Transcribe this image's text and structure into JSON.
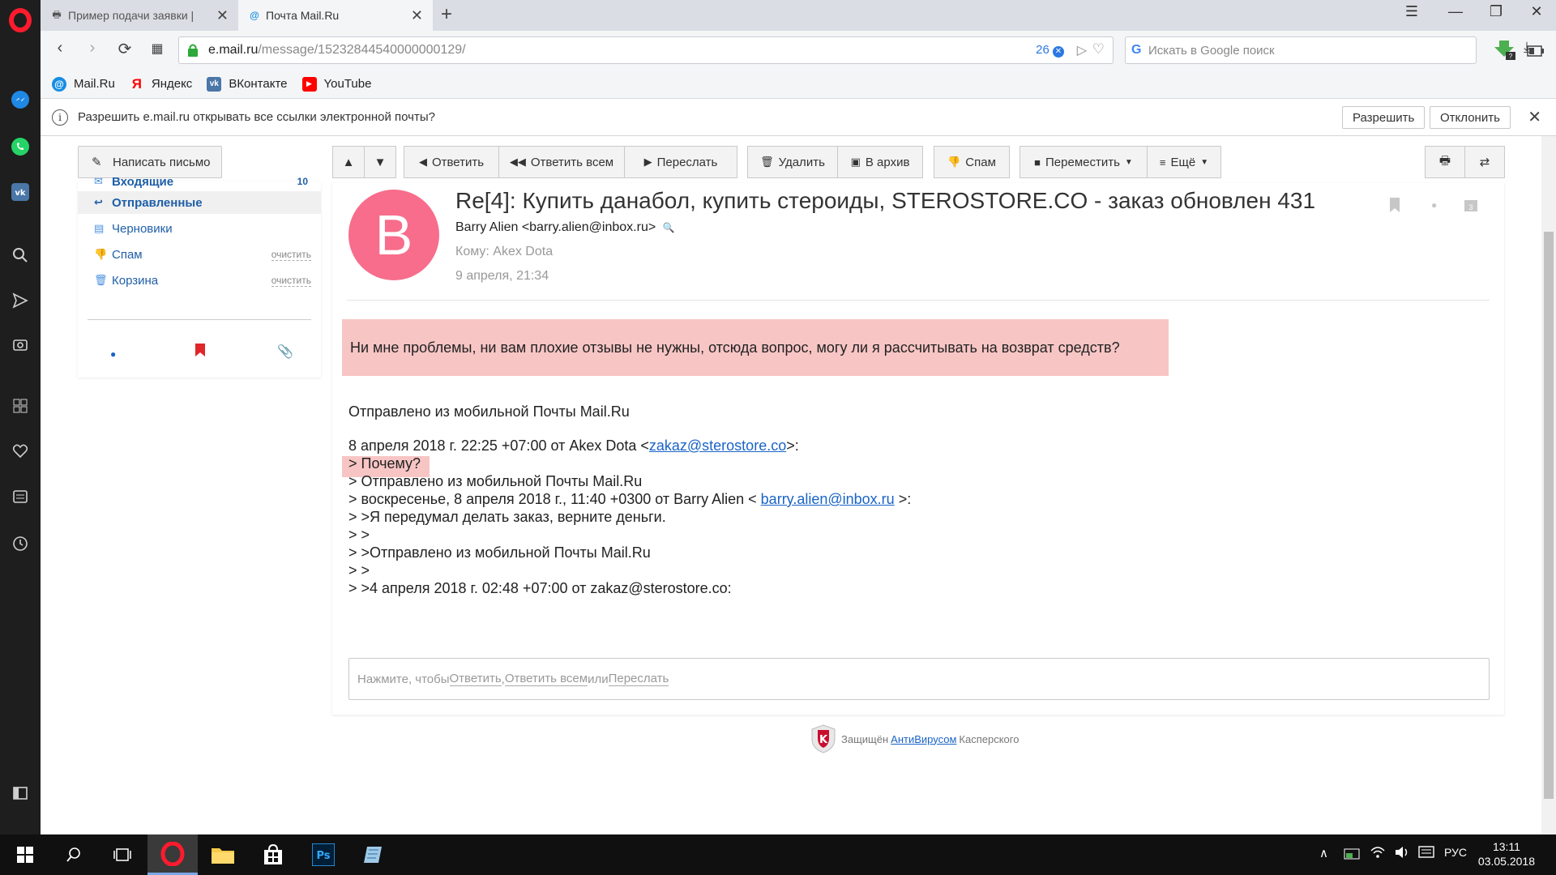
{
  "browser": {
    "tabs": [
      {
        "label": "Пример подачи заявки | ",
        "active": false
      },
      {
        "label": "Почта Mail.Ru",
        "active": true
      }
    ],
    "url_domain": "e.mail.ru",
    "url_path": "/message/15232844540000000129/",
    "url_badge_count": "26",
    "search_placeholder": "Искать в Google поиск",
    "bookmarks": [
      {
        "label": "Mail.Ru",
        "icon": "mailru-icon"
      },
      {
        "label": "Яндекс",
        "icon": "yandex-icon"
      },
      {
        "label": "ВКонтакте",
        "icon": "vk-icon"
      },
      {
        "label": "YouTube",
        "icon": "youtube-icon"
      }
    ],
    "infobar": {
      "text": "Разрешить e.mail.ru открывать все ссылки электронной почты?",
      "allow_label": "Разрешить",
      "deny_label": "Отклонить"
    }
  },
  "mail": {
    "compose_label": "Написать письмо",
    "folders": [
      {
        "label": "Входящие",
        "count": "10"
      },
      {
        "label": "Отправленные",
        "active": true
      },
      {
        "label": "Черновики"
      },
      {
        "label": "Спам",
        "action": "очистить"
      },
      {
        "label": "Корзина",
        "action": "очистить"
      }
    ],
    "toolbar": {
      "reply": "Ответить",
      "reply_all": "Ответить всем",
      "forward": "Переслать",
      "delete": "Удалить",
      "archive": "В архив",
      "spam": "Спам",
      "move": "Переместить",
      "more": "Ещё"
    },
    "message": {
      "avatar_letter": "B",
      "subject": "Re[4]: Купить данабол, купить стероиды, STEROSTORE.CO - заказ обновлен 431",
      "from": "Barry Alien <barry.alien@inbox.ru>",
      "to": "Кому: Akex Dota",
      "date": "9 апреля, 21:34",
      "highlight": "Ни мне проблемы, ни вам плохие отзывы не нужны, отсюда вопрос, могу ли я рассчитывать на возврат средств?",
      "sent_from": "Отправлено из мобильной Почты Mail.Ru",
      "quote_header_pre": "8 апреля 2018 г. 22:25 +07:00 от Akex Dota <",
      "quote_header_link": "zakaz@sterostore.co",
      "quote_header_post": ">:",
      "q1": "> Почему?",
      "q2": "> Отправлено из мобильной Почты Mail.Ru",
      "q3_pre": "> воскресенье, 8 апреля 2018 г., 11:40 +0300 от Barry Alien < ",
      "q3_link": "barry.alien@inbox.ru",
      "q3_post": " >:",
      "q4": "> >Я передумал делать заказ, верните деньги.",
      "q5": "> >",
      "q6": "> >Отправлено из мобильной Почты Mail.Ru",
      "q7": "> >",
      "q8": "> >4 апреля 2018 г. 02:48 +07:00 от zakaz@sterostore.co:"
    },
    "reply_box": {
      "prefix": "Нажмите, чтобы ",
      "reply": "Ответить",
      "sep": ", ",
      "reply_all": "Ответить всем",
      "or": " или ",
      "forward": "Переслать"
    },
    "kaspersky": {
      "pre": "Защищён",
      "link": "АнтиВирусом",
      "post": "Касперского"
    }
  },
  "taskbar": {
    "lang": "РУС",
    "time": "13:11",
    "date": "03.05.2018"
  }
}
